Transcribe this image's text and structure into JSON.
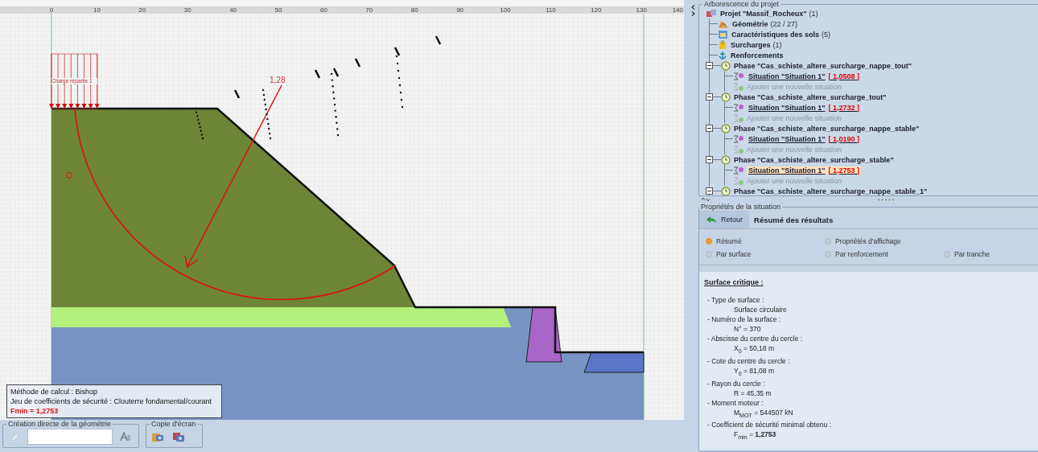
{
  "canvas": {
    "ruler_ticks": [
      "0",
      "10",
      "20",
      "30",
      "40",
      "50",
      "60",
      "70",
      "80",
      "90",
      "100",
      "110",
      "120",
      "130",
      "140"
    ],
    "load_label": "Charge répartie 1",
    "critical_factor": "1,28",
    "info": {
      "method": "Méthode de calcul : Bishop",
      "coefficients": "Jeu de coefficients de sécurité : Clouterre fondamental/courant",
      "fmin": "Fmin = 1,2753"
    }
  },
  "toolbar": {
    "geometry_group": "Création directe de la géométrie",
    "screenshot_group": "Copie d'écran"
  },
  "tree": {
    "title": "Arborescence du projet",
    "root": {
      "label": "Projet \"Massif_Rocheux\"",
      "count": "(1)"
    },
    "items": [
      {
        "kind": "geometry",
        "label": "Géométrie",
        "count": "(22 / 27)"
      },
      {
        "kind": "soils",
        "label": "Caractéristiques des sols",
        "count": "(5)"
      },
      {
        "kind": "loads",
        "label": "Surcharges",
        "count": "(1)"
      },
      {
        "kind": "reinforcements",
        "label": "Renforcements"
      },
      {
        "kind": "phase",
        "label": "Phase \"Cas_schiste_altere_surcharge_nappe_tout\"",
        "expanded": true,
        "children": [
          {
            "kind": "situation",
            "label": "Situation \"Situation 1\"",
            "value": "[ 1,0508 ]",
            "selected": false
          },
          {
            "kind": "add",
            "label": "Ajouter une nouvelle situation"
          }
        ]
      },
      {
        "kind": "phase",
        "label": "Phase \"Cas_schiste_altere_surcharge_tout\"",
        "expanded": true,
        "children": [
          {
            "kind": "situation",
            "label": "Situation \"Situation 1\"",
            "value": "[ 1,2732 ]",
            "selected": false
          },
          {
            "kind": "add",
            "label": "Ajouter une nouvelle situation"
          }
        ]
      },
      {
        "kind": "phase",
        "label": "Phase \"Cas_schiste_altere_surcharge_nappe_stable\"",
        "expanded": true,
        "children": [
          {
            "kind": "situation",
            "label": "Situation \"Situation 1\"",
            "value": "[ 1,0190 ]",
            "selected": false
          },
          {
            "kind": "add",
            "label": "Ajouter une nouvelle situation"
          }
        ]
      },
      {
        "kind": "phase",
        "label": "Phase \"Cas_schiste_altere_surcharge_stable\"",
        "expanded": true,
        "children": [
          {
            "kind": "situation",
            "label": "Situation \"Situation 1\"",
            "value": "[ 1,2753 ]",
            "selected": true
          },
          {
            "kind": "add",
            "label": "Ajouter une nouvelle situation"
          }
        ]
      },
      {
        "kind": "phase",
        "label": "Phase \"Cas_schiste_altere_surcharge_nappe_stable_1\"",
        "expanded": true
      }
    ]
  },
  "properties": {
    "title": "Propriétés de la situation",
    "back_button": "Retour",
    "heading": "Résumé des résultats",
    "option_rows": [
      [
        {
          "label": "Résumé",
          "selected": true
        },
        {
          "label": "Propriétés d'affichage",
          "selected": false
        }
      ],
      [
        {
          "label": "Par surface",
          "selected": false
        },
        {
          "label": "Par renforcement",
          "selected": false
        },
        {
          "label": "Par tranche",
          "selected": false
        }
      ]
    ],
    "results": {
      "title": "Surface critique :",
      "items": [
        {
          "label": "- Type de surface :",
          "value": "Surface circulaire"
        },
        {
          "label": "- Numéro de la surface :",
          "value": "N° = 370"
        },
        {
          "label": "- Abscisse du centre du cercle :",
          "value": "X$_{0}$ = 50,18 m"
        },
        {
          "label": "- Cote du centre du cercle :",
          "value": "Y$_{0}$ = 81,08 m"
        },
        {
          "label": "- Rayon du cercle :",
          "value": "R = 45,35 m"
        },
        {
          "label": "- Moment moteur :",
          "value": "M$_{MOT}$ = 544507 kN"
        },
        {
          "label": "- Coefficient de sécurité minimal obtenu :",
          "value": "F$_{min}$ = **1,2753**"
        }
      ]
    }
  }
}
